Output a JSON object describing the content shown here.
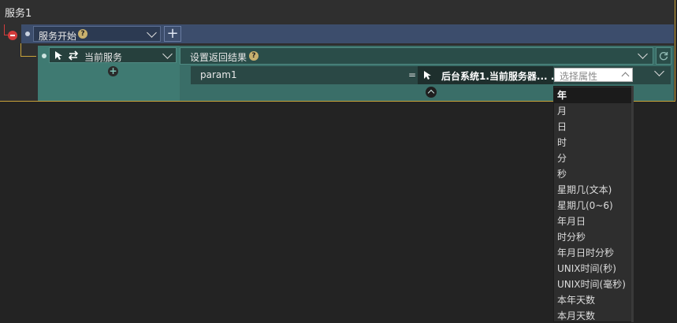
{
  "service": {
    "title": "服务1"
  },
  "start": {
    "label": "服务开始",
    "help": "?",
    "add_label": "+"
  },
  "current_service": {
    "label": "当前服务",
    "add_label": "+"
  },
  "return_block": {
    "label": "设置返回结果",
    "help": "?"
  },
  "param": {
    "name": "param1",
    "equals": "=",
    "value": "后台系统1.当前服务器... ."
  },
  "property_select": {
    "placeholder": "选择属性"
  },
  "dropdown": {
    "selected_index": 0,
    "options": [
      "年",
      "月",
      "日",
      "时",
      "分",
      "秒",
      "星期几(文本)",
      "星期几(0~6)",
      "年月日",
      "时分秒",
      "年月日时分秒",
      "UNIX时间(秒)",
      "UNIX时间(毫秒)",
      "本年天数",
      "本月天数"
    ]
  },
  "colors": {
    "accent": "#c8a23a",
    "stop": "#d23c3c",
    "header": "#3c4d6c",
    "teal": "#3f7a72"
  },
  "icons": [
    "stop-icon",
    "help-icon",
    "chevron-down-icon",
    "plus-icon",
    "cursor-icon",
    "swap-icon",
    "plus-circle-icon",
    "refresh-icon",
    "chevron-up-icon"
  ]
}
